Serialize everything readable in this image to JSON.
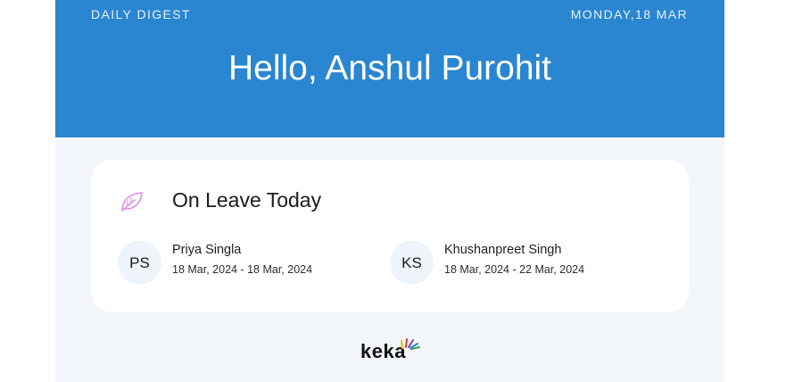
{
  "header": {
    "digest_label": "DAILY DIGEST",
    "date_label": "MONDAY,18 MAR",
    "greeting": "Hello, Anshul Purohit",
    "background": "#2a86d1"
  },
  "on_leave": {
    "title": "On Leave Today",
    "icon": "leaf-icon",
    "icon_color": "#e48ee4",
    "people": [
      {
        "initials": "PS",
        "name": "Priya Singla",
        "dates": "18 Mar, 2024 - 18 Mar, 2024"
      },
      {
        "initials": "KS",
        "name": "Khushanpreet Singh",
        "dates": "18 Mar, 2024 - 22 Mar, 2024"
      }
    ]
  },
  "footer": {
    "logo_text": "keka",
    "logo_icon": "keka-rays-icon",
    "ray_colors": [
      "#f4b400",
      "#e53935",
      "#8e44ad",
      "#1e88e5",
      "#43a047"
    ]
  }
}
